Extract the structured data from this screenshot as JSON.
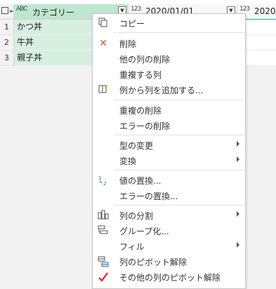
{
  "columns": {
    "category": {
      "type_icon": "ABC",
      "name": "カテゴリー"
    },
    "date": {
      "type_icon": "123",
      "name": "2020/01/01"
    },
    "date2": {
      "type_icon": "123",
      "name": "2020/"
    }
  },
  "rows": [
    {
      "num": "1",
      "category": "かつ丼"
    },
    {
      "num": "2",
      "category": "牛丼"
    },
    {
      "num": "3",
      "category": "親子丼"
    }
  ],
  "context_menu": {
    "copy": "コピー",
    "remove": "削除",
    "remove_other_columns": "他の列の削除",
    "duplicate_column": "重複する列",
    "add_column_from_examples": "例から列を追加する...",
    "remove_duplicates": "重複の削除",
    "remove_errors": "エラーの削除",
    "change_type": "型の変更",
    "transform": "変換",
    "replace_values": "値の置換...",
    "replace_errors": "エラーの置換...",
    "split_column": "列の分割",
    "group_by": "グループ化...",
    "fill": "フィル",
    "unpivot_columns": "列のピボット解除",
    "unpivot_other_columns": "その他の列のピボット解除"
  },
  "icons": {
    "copy": "copy-icon",
    "remove": "delete-x-icon",
    "add_column_from_examples": "add-column-icon",
    "replace_values": "replace-values-icon",
    "split_column": "split-column-icon",
    "group_by": "group-by-icon",
    "unpivot_columns": "unpivot-icon",
    "unpivot_other_columns": "checkmark-icon"
  },
  "colors": {
    "selected_column_header": "#bfe6cf",
    "selected_column_cells": "#d7efe0",
    "accent_teal": "#2aa7a1",
    "delete_icon": "#e05a3b",
    "checkmark": "#d9262b"
  }
}
